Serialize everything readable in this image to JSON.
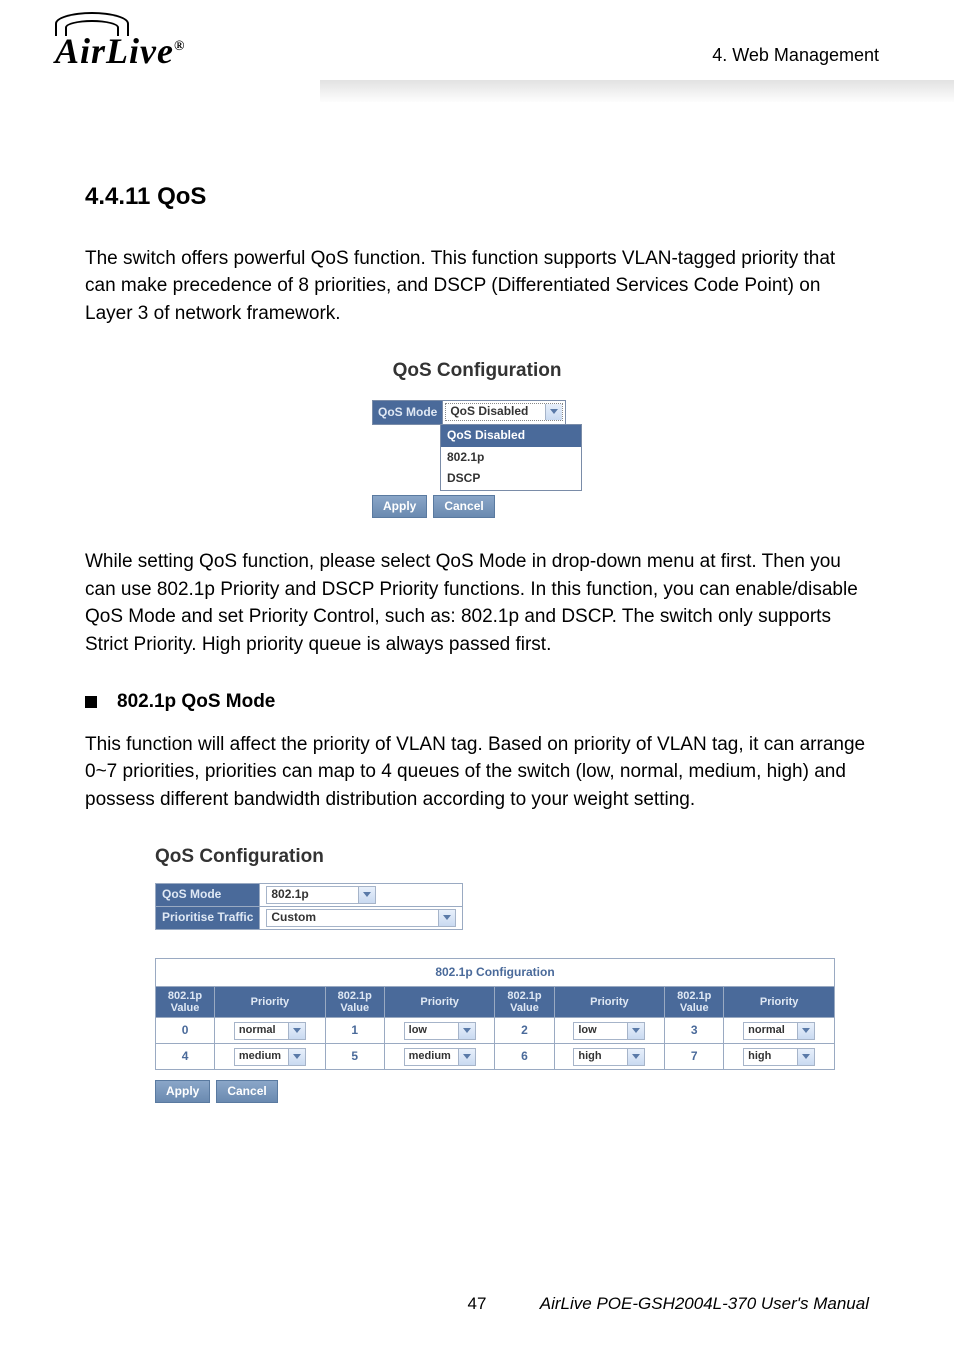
{
  "brand": "AirLive",
  "chapter_label": "4.  Web  Management",
  "section_number": "4.4.11 QoS",
  "intro_para": "The switch offers powerful QoS function. This function supports VLAN-tagged priority that can make precedence of 8 priorities, and DSCP (Differentiated Services Code Point) on Layer 3 of network framework.",
  "fig1": {
    "title": "QoS Configuration",
    "mode_label": "QoS Mode",
    "selected": "QoS Disabled",
    "options": [
      "QoS Disabled",
      "802.1p",
      "DSCP"
    ],
    "apply": "Apply",
    "cancel": "Cancel"
  },
  "mid_para": "While setting QoS function, please select QoS Mode in drop-down menu at first. Then you can use 802.1p Priority and DSCP Priority functions. In this function, you can enable/disable QoS Mode and set Priority Control, such as: 802.1p and DSCP. The switch only supports Strict Priority. High priority queue is always passed first.",
  "bullet_title": "802.1p QoS Mode",
  "bullet_para": "This function will affect the priority of VLAN tag. Based on priority of VLAN tag, it can arrange 0~7 priorities, priorities can map to 4 queues of the switch (low, normal, medium, high) and possess different bandwidth distribution according to your weight setting.",
  "fig2": {
    "title": "QoS Configuration",
    "rows": [
      {
        "label": "QoS Mode",
        "value": "802.1p"
      },
      {
        "label": "Prioritise Traffic",
        "value": "Custom"
      }
    ],
    "apply": "Apply",
    "cancel": "Cancel",
    "ptable": {
      "title": "802.1p Configuration",
      "col_value": "802.1p Value",
      "col_priority": "Priority",
      "cells": [
        {
          "v": "0",
          "p": "normal"
        },
        {
          "v": "1",
          "p": "low"
        },
        {
          "v": "2",
          "p": "low"
        },
        {
          "v": "3",
          "p": "normal"
        },
        {
          "v": "4",
          "p": "medium"
        },
        {
          "v": "5",
          "p": "medium"
        },
        {
          "v": "6",
          "p": "high"
        },
        {
          "v": "7",
          "p": "high"
        }
      ]
    }
  },
  "footer": {
    "page": "47",
    "manual": "AirLive POE-GSH2004L-370 User's Manual"
  },
  "chart_data": {
    "type": "table",
    "title": "802.1p Configuration",
    "columns": [
      "802.1p Value",
      "Priority"
    ],
    "rows": [
      [
        0,
        "normal"
      ],
      [
        1,
        "low"
      ],
      [
        2,
        "low"
      ],
      [
        3,
        "normal"
      ],
      [
        4,
        "medium"
      ],
      [
        5,
        "medium"
      ],
      [
        6,
        "high"
      ],
      [
        7,
        "high"
      ]
    ]
  }
}
